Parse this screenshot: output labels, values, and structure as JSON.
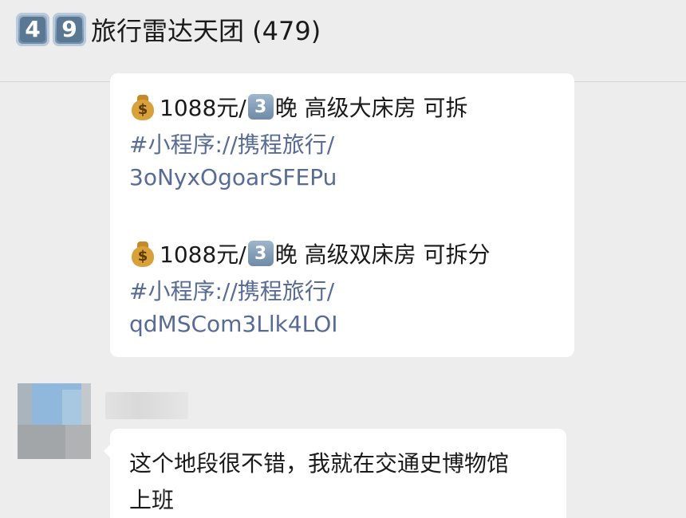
{
  "header": {
    "title_emoji_digits": [
      "4",
      "9"
    ],
    "title": "旅行雷达天团 (479)"
  },
  "messages": [
    {
      "lines": [
        {
          "icon": "moneybag-icon",
          "price": "1088元/",
          "nights_digit": "3",
          "text": "晚 高级大床房 可拆"
        },
        {
          "link": "#小程序://携程旅行/"
        },
        {
          "link": "3oNyxOgoarSFEPu"
        },
        {
          "icon": "moneybag-icon",
          "price": "1088元/",
          "nights_digit": "3",
          "text": "晚 高级双床房 可拆分"
        },
        {
          "link": "#小程序://携程旅行/"
        },
        {
          "link": "qdMSCom3Llk4LOI"
        }
      ]
    },
    {
      "lines": [
        "这个地段很不错，我就在交通史博物馆",
        "上班"
      ]
    }
  ],
  "colors": {
    "background": "#ededed",
    "bubble": "#ffffff",
    "link": "#576b95",
    "text": "#1a1a1a"
  }
}
